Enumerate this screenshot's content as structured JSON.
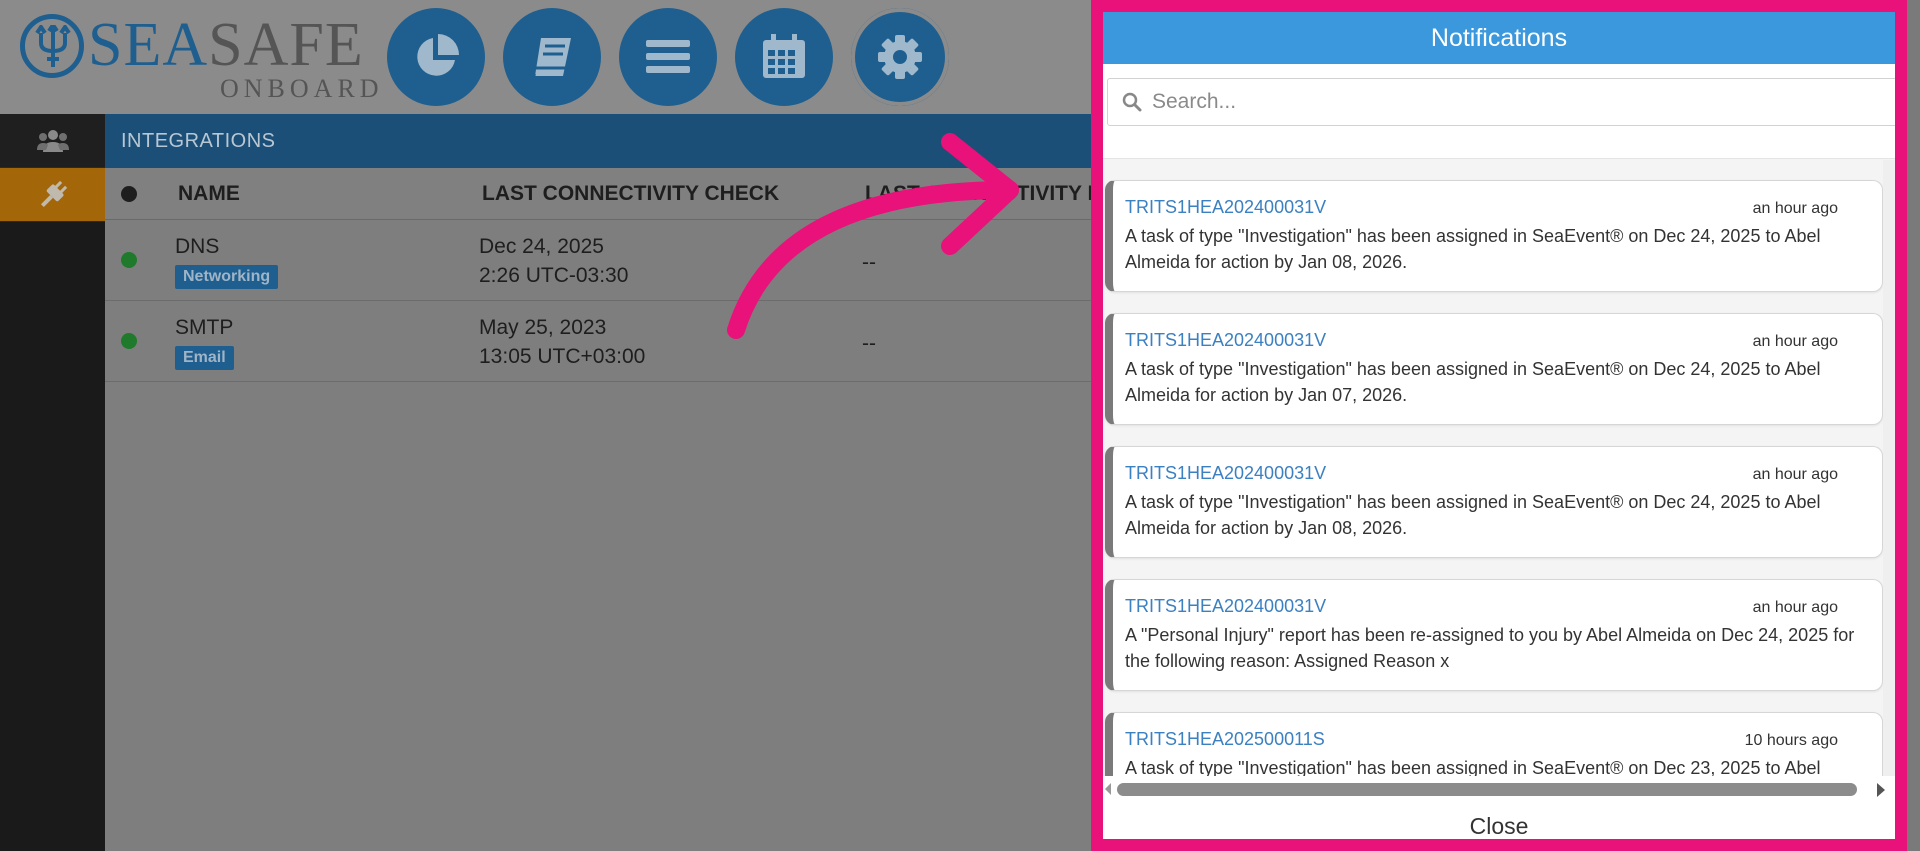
{
  "app": {
    "logo": {
      "word_primary": "SEA",
      "word_secondary": "SAFE",
      "subtitle": "ONBOARD"
    },
    "nav_buttons": [
      {
        "icon": "pie-chart-icon"
      },
      {
        "icon": "book-icon"
      },
      {
        "icon": "menu-icon"
      },
      {
        "icon": "calendar-icon"
      },
      {
        "icon": "gear-icon"
      }
    ],
    "sidebar": [
      {
        "icon": "users-icon",
        "active": false
      },
      {
        "icon": "plug-icon",
        "active": true
      }
    ],
    "section_title": "INTEGRATIONS",
    "table": {
      "headers": [
        "NAME",
        "LAST CONNECTIVITY CHECK",
        "LAST CONNECTIVITY E"
      ],
      "rows": [
        {
          "name": "DNS",
          "tag": "Networking",
          "check_date": "Dec 24, 2025",
          "check_time": "2:26 UTC-03:30",
          "last": "--"
        },
        {
          "name": "SMTP",
          "tag": "Email",
          "check_date": "May 25, 2023",
          "check_time": "13:05 UTC+03:00",
          "last": "--"
        }
      ]
    },
    "colors": {
      "brand_blue": "#1f5f8f",
      "header_blue": "#3b98dc",
      "highlight": "#e8127a",
      "status_ok": "#1f7a2b",
      "active_side": "#a3670a"
    }
  },
  "notifications": {
    "title": "Notifications",
    "search_placeholder": "Search...",
    "items": [
      {
        "id": "TRITS1HEA202400031V",
        "time": "an hour ago",
        "message": "A task of type \"Investigation\" has been assigned in SeaEvent® on Dec 24, 2025 to Abel Almeida for action by Jan 08, 2026."
      },
      {
        "id": "TRITS1HEA202400031V",
        "time": "an hour ago",
        "message": "A task of type \"Investigation\" has been assigned in SeaEvent® on Dec 24, 2025 to Abel Almeida for action by Jan 07, 2026."
      },
      {
        "id": "TRITS1HEA202400031V",
        "time": "an hour ago",
        "message": "A task of type \"Investigation\" has been assigned in SeaEvent® on Dec 24, 2025 to Abel Almeida for action by Jan 08, 2026."
      },
      {
        "id": "TRITS1HEA202400031V",
        "time": "an hour ago",
        "message": "A \"Personal Injury\" report has been re-assigned to you by Abel Almeida on Dec 24, 2025 for the following reason: Assigned Reason x"
      },
      {
        "id": "TRITS1HEA202500011S",
        "time": "10 hours ago",
        "message": "A task of type \"Investigation\" has been assigned in SeaEvent® on Dec 23, 2025 to Abel"
      }
    ],
    "close_label": "Close"
  }
}
